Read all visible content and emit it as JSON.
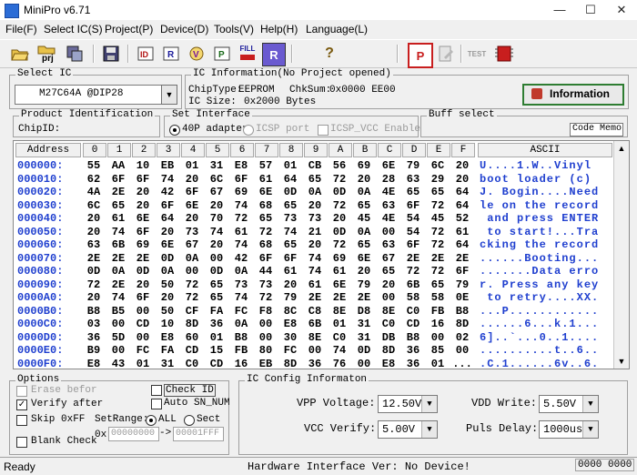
{
  "window": {
    "title": "MiniPro v6.71",
    "minimize": "—",
    "maximize": "☐",
    "close": "✕"
  },
  "menu": [
    {
      "label": "File(F)"
    },
    {
      "label": "Select IC(S)"
    },
    {
      "label": "Project(P)"
    },
    {
      "label": "Device(D)"
    },
    {
      "label": "Tools(V)"
    },
    {
      "label": "Help(H)"
    },
    {
      "label": "Language(L)"
    }
  ],
  "toolbar": {
    "prj_label": "prj",
    "fill_label": "FILL",
    "test_label": "TEST",
    "icons": [
      "open-folder-icon",
      "project-icon",
      "save-project-icon",
      "save-icon",
      "read-id-icon",
      "read-icon",
      "verify-icon",
      "program-icon",
      "fill-icon",
      "read-chip-icon",
      "help-icon",
      "protect-icon",
      "edit-icon",
      "test-icon",
      "chip-icon"
    ]
  },
  "select_ic": {
    "title": "Select IC",
    "value": "M27C64A @DIP28"
  },
  "ic_info": {
    "title": "IC Information(No Project opened)",
    "chiptype_label": "ChipType:",
    "chiptype": "EEPROM",
    "chksum_label": "ChkSum:",
    "chksum": "0x0000 EE00",
    "size_label": "IC Size:",
    "size": "0x2000 Bytes",
    "info_button": "Information"
  },
  "product_id": {
    "title": "Product Identification",
    "chipid_label": "ChipID:"
  },
  "interface": {
    "title": "Set Interface",
    "opt_40p": "40P adapter",
    "opt_icsp": "ICSP port",
    "icsp_vcc": "ICSP_VCC Enable"
  },
  "buff": {
    "title": "Buff select",
    "value": "Code Memo"
  },
  "hex": {
    "headers": [
      "Address",
      "0",
      "1",
      "2",
      "3",
      "4",
      "5",
      "6",
      "7",
      "8",
      "9",
      "A",
      "B",
      "C",
      "D",
      "E",
      "F",
      "ASCII"
    ],
    "rows": [
      {
        "addr": "000000:",
        "bytes": [
          "55",
          "AA",
          "10",
          "EB",
          "01",
          "31",
          "E8",
          "57",
          "01",
          "CB",
          "56",
          "69",
          "6E",
          "79",
          "6C",
          "20"
        ],
        "ascii": "U....1.W..Vinyl "
      },
      {
        "addr": "000010:",
        "bytes": [
          "62",
          "6F",
          "6F",
          "74",
          "20",
          "6C",
          "6F",
          "61",
          "64",
          "65",
          "72",
          "20",
          "28",
          "63",
          "29",
          "20"
        ],
        "ascii": "boot loader (c) "
      },
      {
        "addr": "000020:",
        "bytes": [
          "4A",
          "2E",
          "20",
          "42",
          "6F",
          "67",
          "69",
          "6E",
          "0D",
          "0A",
          "0D",
          "0A",
          "4E",
          "65",
          "65",
          "64"
        ],
        "ascii": "J. Bogin....Need"
      },
      {
        "addr": "000030:",
        "bytes": [
          "6C",
          "65",
          "20",
          "6F",
          "6E",
          "20",
          "74",
          "68",
          "65",
          "20",
          "72",
          "65",
          "63",
          "6F",
          "72",
          "64"
        ],
        "ascii": "le on the record"
      },
      {
        "addr": "000040:",
        "bytes": [
          "20",
          "61",
          "6E",
          "64",
          "20",
          "70",
          "72",
          "65",
          "73",
          "73",
          "20",
          "45",
          "4E",
          "54",
          "45",
          "52"
        ],
        "ascii": " and press ENTER"
      },
      {
        "addr": "000050:",
        "bytes": [
          "20",
          "74",
          "6F",
          "20",
          "73",
          "74",
          "61",
          "72",
          "74",
          "21",
          "0D",
          "0A",
          "00",
          "54",
          "72",
          "61"
        ],
        "ascii": " to start!...Tra"
      },
      {
        "addr": "000060:",
        "bytes": [
          "63",
          "6B",
          "69",
          "6E",
          "67",
          "20",
          "74",
          "68",
          "65",
          "20",
          "72",
          "65",
          "63",
          "6F",
          "72",
          "64"
        ],
        "ascii": "cking the record"
      },
      {
        "addr": "000070:",
        "bytes": [
          "2E",
          "2E",
          "2E",
          "0D",
          "0A",
          "00",
          "42",
          "6F",
          "6F",
          "74",
          "69",
          "6E",
          "67",
          "2E",
          "2E",
          "2E"
        ],
        "ascii": "......Booting..."
      },
      {
        "addr": "000080:",
        "bytes": [
          "0D",
          "0A",
          "0D",
          "0A",
          "00",
          "0D",
          "0A",
          "44",
          "61",
          "74",
          "61",
          "20",
          "65",
          "72",
          "72",
          "6F"
        ],
        "ascii": ".......Data erro"
      },
      {
        "addr": "000090:",
        "bytes": [
          "72",
          "2E",
          "20",
          "50",
          "72",
          "65",
          "73",
          "73",
          "20",
          "61",
          "6E",
          "79",
          "20",
          "6B",
          "65",
          "79"
        ],
        "ascii": "r. Press any key"
      },
      {
        "addr": "0000A0:",
        "bytes": [
          "20",
          "74",
          "6F",
          "20",
          "72",
          "65",
          "74",
          "72",
          "79",
          "2E",
          "2E",
          "2E",
          "00",
          "58",
          "58",
          "0E"
        ],
        "ascii": " to retry....XX."
      },
      {
        "addr": "0000B0:",
        "bytes": [
          "B8",
          "B5",
          "00",
          "50",
          "CF",
          "FA",
          "FC",
          "F8",
          "8C",
          "C8",
          "8E",
          "D8",
          "8E",
          "C0",
          "FB",
          "B8"
        ],
        "ascii": "...P............"
      },
      {
        "addr": "0000C0:",
        "bytes": [
          "03",
          "00",
          "CD",
          "10",
          "8D",
          "36",
          "0A",
          "00",
          "E8",
          "6B",
          "01",
          "31",
          "C0",
          "CD",
          "16",
          "8D"
        ],
        "ascii": "......6...k.1..."
      },
      {
        "addr": "0000D0:",
        "bytes": [
          "36",
          "5D",
          "00",
          "E8",
          "60",
          "01",
          "B8",
          "00",
          "30",
          "8E",
          "C0",
          "31",
          "DB",
          "B8",
          "00",
          "02"
        ],
        "ascii": "6]..`...0..1...."
      },
      {
        "addr": "0000E0:",
        "bytes": [
          "B9",
          "00",
          "FC",
          "FA",
          "CD",
          "15",
          "FB",
          "80",
          "FC",
          "00",
          "74",
          "0D",
          "8D",
          "36",
          "85",
          "00"
        ],
        "ascii": "..........t..6.."
      },
      {
        "addr": "0000F0:",
        "bytes": [
          "E8",
          "43",
          "01",
          "31",
          "C0",
          "CD",
          "16",
          "EB",
          "8D",
          "36",
          "76",
          "00",
          "E8",
          "36",
          "01",
          "..."
        ],
        "ascii": ".C.1......6v..6."
      }
    ]
  },
  "options": {
    "title": "Options",
    "erase": "Erase befor",
    "verify": "Verify after",
    "skip": "Skip 0xFF",
    "blank": "Blank Check",
    "check_id": "Check ID",
    "auto_sn": "Auto SN_NUM",
    "setrange_label": "SetRange:",
    "range_all": "ALL",
    "range_sect": "Sect",
    "range_prefix": "0x",
    "range_from": "00000000",
    "range_arrow": "->",
    "range_to": "00001FFF"
  },
  "ic_config": {
    "title": "IC Config Informaton",
    "vpp_label": "VPP Voltage:",
    "vpp": "12.50V",
    "vcc_label": "VCC Verify:",
    "vcc": "5.00V",
    "vdd_label": "VDD Write:",
    "vdd": "5.50V",
    "pulse_label": "Puls Delay:",
    "pulse": "1000us"
  },
  "status": {
    "ready": "Ready",
    "hardware": "Hardware Interface Ver: No Device!",
    "counter": "0000 0000"
  },
  "colors": {
    "address_blue": "#1f3fcf",
    "info_border": "#2e7d32",
    "info_icon": "#c0392b"
  }
}
